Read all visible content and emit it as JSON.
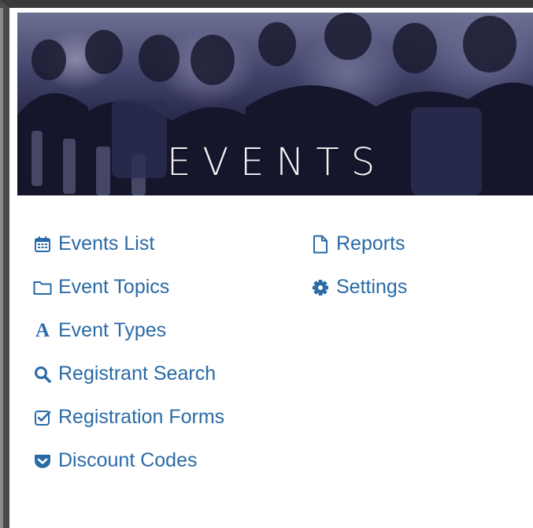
{
  "banner": {
    "title": "EVENTS"
  },
  "menu": {
    "column_left": [
      {
        "label": "Events List",
        "icon": "calendar-icon"
      },
      {
        "label": "Event Topics",
        "icon": "folder-icon"
      },
      {
        "label": "Event Types",
        "icon": "font-icon",
        "glyph": "A"
      },
      {
        "label": "Registrant Search",
        "icon": "search-icon"
      },
      {
        "label": "Registration Forms",
        "icon": "check-square-icon"
      },
      {
        "label": "Discount Codes",
        "icon": "pocket-icon"
      }
    ],
    "column_right": [
      {
        "label": "Reports",
        "icon": "file-icon"
      },
      {
        "label": "Settings",
        "icon": "gear-icon"
      }
    ]
  },
  "colors": {
    "link": "#2a6aa6",
    "banner_dark": "#0e0f22"
  }
}
